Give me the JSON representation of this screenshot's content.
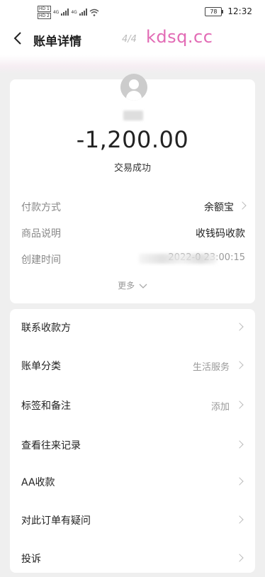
{
  "status_bar": {
    "sim1": "HD 1",
    "sim2": "HD 2",
    "net1": "4G",
    "net2": "4G",
    "battery": "78",
    "time": "12:32"
  },
  "header": {
    "title": "账单详情",
    "page_indicator": "4/4"
  },
  "watermark": "kdsq.cc",
  "summary": {
    "amount": "-1,200.00",
    "status": "交易成功",
    "rows": [
      {
        "key": "付款方式",
        "value": "余额宝"
      },
      {
        "key": "商品说明",
        "value": "收钱码收款"
      },
      {
        "key": "创建时间",
        "value": "2022-0 23:00:15"
      }
    ],
    "more_label": "更多"
  },
  "actions": [
    {
      "label": "联系收款方",
      "value": ""
    },
    {
      "label": "账单分类",
      "value": "生活服务"
    },
    {
      "label": "标签和备注",
      "value": "添加"
    },
    {
      "label": "查看往来记录",
      "value": ""
    },
    {
      "label": "AA收款",
      "value": ""
    },
    {
      "label": "对此订单有疑问",
      "value": ""
    },
    {
      "label": "投诉",
      "value": ""
    }
  ]
}
